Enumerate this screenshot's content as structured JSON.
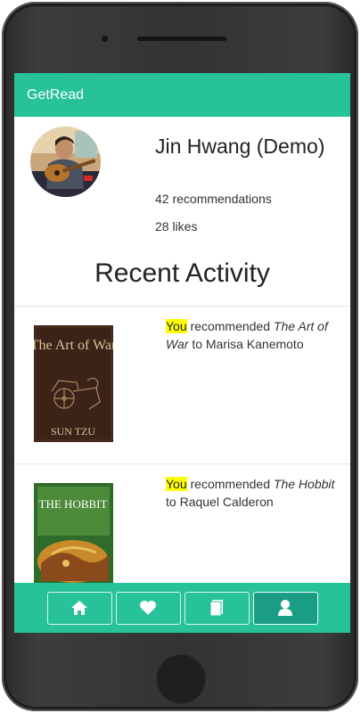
{
  "app": {
    "brand": "GetRead"
  },
  "profile": {
    "name": "Jin Hwang (Demo)",
    "recommendations": "42 recommendations",
    "likes": "28 likes"
  },
  "recent_activity": {
    "title": "Recent Activity",
    "items": [
      {
        "actor": "You",
        "verb": "recommended",
        "book": "The Art of War",
        "connector": "to",
        "recipient": "Marisa Kanemoto",
        "cover_title": "The Art of War",
        "cover_author": "SUN TZU"
      },
      {
        "actor": "You",
        "verb": "recommended",
        "book": "The Hobbit",
        "connector": "to",
        "recipient": "Raquel Calderon",
        "cover_title": "THE HOBBIT"
      }
    ]
  },
  "tabs": [
    {
      "icon": "home-icon",
      "active": false
    },
    {
      "icon": "heart-icon",
      "active": false
    },
    {
      "icon": "book-icon",
      "active": false
    },
    {
      "icon": "user-icon",
      "active": true
    }
  ],
  "colors": {
    "accent": "#27c19a",
    "active_tab": "#1b9c85",
    "highlight": "#ffff00"
  }
}
